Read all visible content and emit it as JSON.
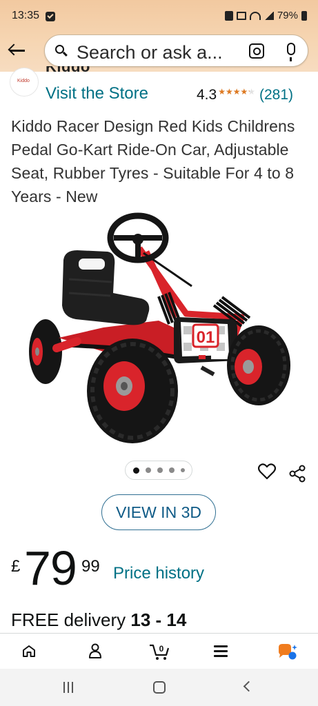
{
  "status_bar": {
    "time": "13:35",
    "battery": "79%"
  },
  "search": {
    "placeholder": "Search or ask a..."
  },
  "brand": {
    "logo_text": "Kiddo",
    "name": "Kiddo",
    "visit_store": "Visit the Store"
  },
  "rating": {
    "value": "4.3",
    "stars": "★★★★★",
    "count": "(281)",
    "fraction": 0.86
  },
  "product": {
    "title": "Kiddo Racer Design Red Kids Childrens Pedal Go-Kart Ride-On Car, Adjustable Seat, Rubber Tyres - Suitable For 4 to 8 Years - New",
    "plate_number": "01",
    "image_count": 5,
    "active_image": 1,
    "view_3d_label": "VIEW IN 3D"
  },
  "price": {
    "currency": "£",
    "whole": "79",
    "fraction": "99",
    "history_link": "Price history"
  },
  "delivery": {
    "free": "FREE",
    "text": " delivery ",
    "dates": "13 - 14"
  },
  "bottom_nav": {
    "cart_count": "0",
    "items": [
      "home-icon",
      "user-icon",
      "cart-icon",
      "menu-icon",
      "ai-assistant-icon"
    ]
  },
  "colors": {
    "link": "#007185",
    "star": "#de7921",
    "banner": "#f6d6b3",
    "kart_red": "#d9242b"
  }
}
